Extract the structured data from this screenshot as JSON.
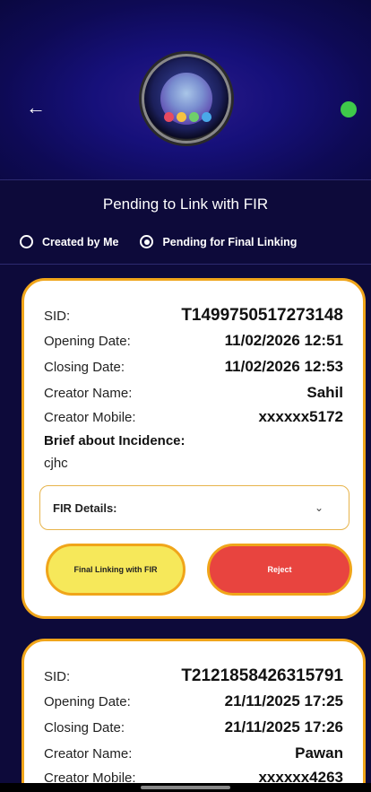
{
  "header": {
    "online_color": "#3fc94a",
    "logo_dots": [
      "#e84a5f",
      "#f5c242",
      "#6fcf6a",
      "#4aa8e8",
      "#b56ad8"
    ]
  },
  "page": {
    "title": "Pending to Link with FIR"
  },
  "filters": {
    "options": [
      {
        "label": "Created by Me",
        "checked": false
      },
      {
        "label": "Pending for Final Linking",
        "checked": true
      }
    ]
  },
  "cards": [
    {
      "sid_label": "SID:",
      "sid": "T1499750517273148",
      "opening_label": "Opening Date:",
      "opening": "11/02/2026 12:51",
      "closing_label": "Closing Date:",
      "closing": "11/02/2026 12:53",
      "creator_label": "Creator Name:",
      "creator": "Sahil",
      "mobile_label": "Creator Mobile:",
      "mobile": "xxxxxx5172",
      "brief_label": "Brief about Incidence:",
      "brief": "cjhc",
      "fir_label": "FIR Details:",
      "link_label": "Final Linking with FIR",
      "reject_label": "Reject"
    },
    {
      "sid_label": "SID:",
      "sid": "T2121858426315791",
      "opening_label": "Opening Date:",
      "opening": "21/11/2025 17:25",
      "closing_label": "Closing Date:",
      "closing": "21/11/2025 17:26",
      "creator_label": "Creator Name:",
      "creator": "Pawan",
      "mobile_label": "Creator Mobile:",
      "mobile": "xxxxxx4263"
    }
  ]
}
